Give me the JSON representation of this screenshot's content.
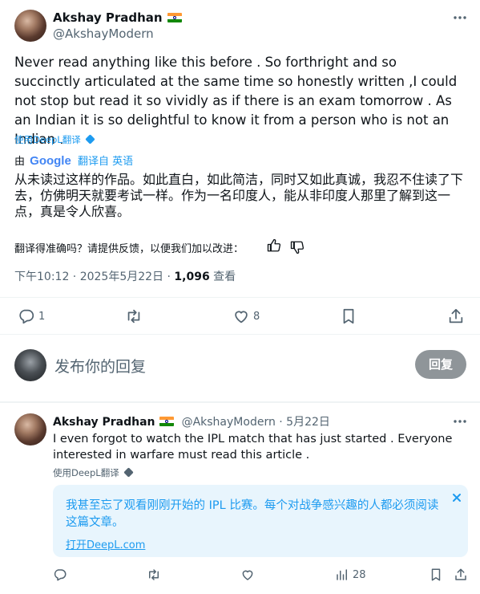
{
  "tweet": {
    "author_name": "Akshay Pradhan",
    "author_handle": "@AkshayModern",
    "text": "Never read anything like this before . So forthright and so succinctly articulated at the same time so honestly written ,I could not stop but read it so vividly as if there is an exam tomorrow . As an Indian it is so delightful to know it from a person who is not an Indian .",
    "deepl_label": "使用DeepL翻译",
    "translated_by_prefix": "由",
    "google_logo_text": "Google",
    "translated_from": "翻译自 英语",
    "translation": "从未读过这样的作品。如此直白，如此简洁，同时又如此真诚，我忍不住读了下去，仿佛明天就要考试一样。作为一名印度人，能从非印度人那里了解到这一点，真是令人欣喜。",
    "feedback_prompt": "翻译得准确吗？请提供反馈，以便我们加以改进：",
    "timestamp": "下午10:12 · 2025年5月22日 · ",
    "views_count": "1,096",
    "views_label": " 查看",
    "replies": "1",
    "likes": "8"
  },
  "composer": {
    "placeholder": "发布你的回复",
    "reply_button": "回复"
  },
  "reply_tweet": {
    "author_name": "Akshay Pradhan",
    "author_handle": "@AkshayModern · 5月22日",
    "text": "I even forgot to watch the IPL match that has just started . Everyone interested in warfare must read this article .",
    "deepl_label": "使用DeepL翻译",
    "translation": "我甚至忘了观看刚刚开始的 IPL 比赛。每个对战争感兴趣的人都必须阅读这篇文章。",
    "open_deepl": "打开DeepL.com",
    "views": "28"
  },
  "colors": {
    "accent": "#1d9bf0",
    "text": "#0f1419",
    "secondary": "#536471",
    "reply_button": "#8f9599",
    "translation_box": "#e8f5fd"
  }
}
